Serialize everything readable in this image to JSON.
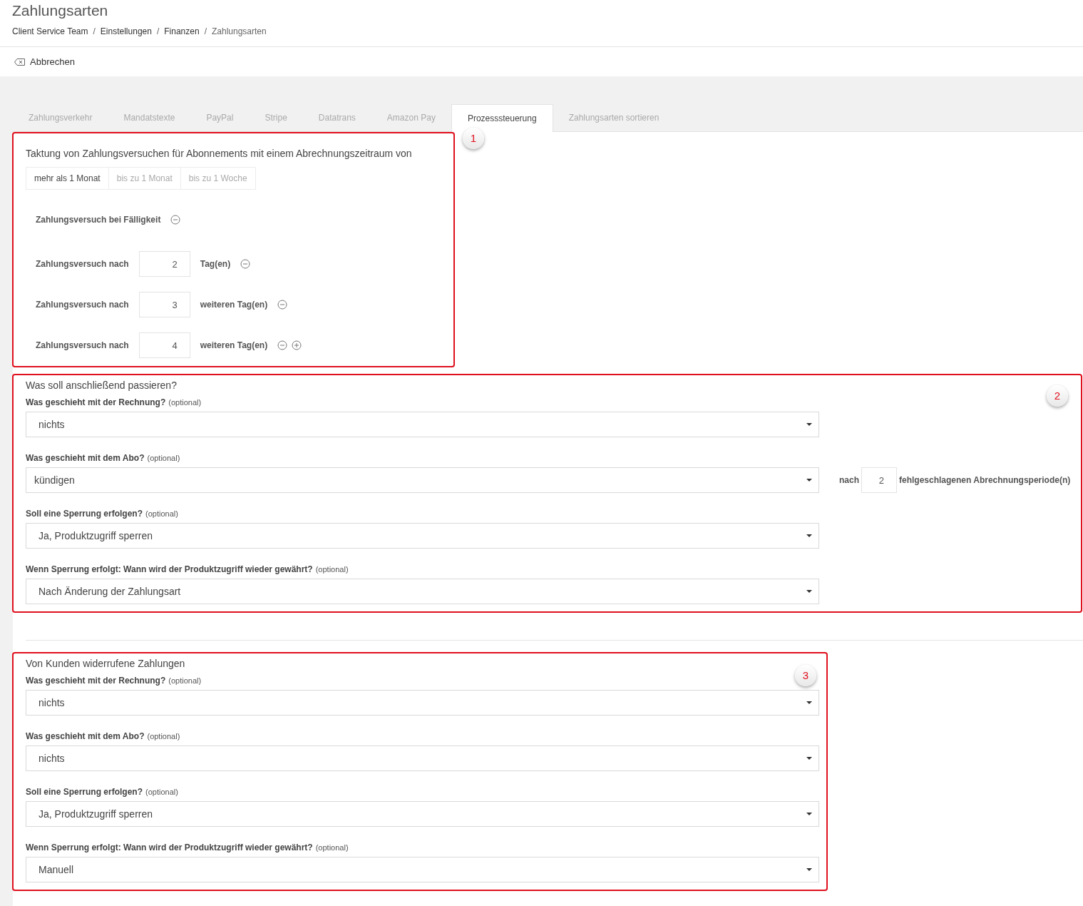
{
  "page_title": "Zahlungsarten",
  "breadcrumb": [
    {
      "label": "Client Service Team",
      "current": false
    },
    {
      "label": "Einstellungen",
      "current": false
    },
    {
      "label": "Finanzen",
      "current": false
    },
    {
      "label": "Zahlungsarten",
      "current": true
    }
  ],
  "breadcrumb_separator": "/",
  "cancel_button": "Abbrechen",
  "tabs": [
    {
      "label": "Zahlungsverkehr",
      "selected": false
    },
    {
      "label": "Mandatstexte",
      "selected": false
    },
    {
      "label": "PayPal",
      "selected": false
    },
    {
      "label": "Stripe",
      "selected": false
    },
    {
      "label": "Datatrans",
      "selected": false
    },
    {
      "label": "Amazon Pay",
      "selected": false
    },
    {
      "label": "Prozesssteuerung",
      "selected": true
    },
    {
      "label": "Zahlungsarten sortieren",
      "selected": false
    }
  ],
  "schedule": {
    "annotation": "1",
    "title": "Taktung von Zahlungsversuchen für Abonnements mit einem Abrechnungszeitraum von",
    "periods": [
      {
        "label": "mehr als 1 Monat",
        "selected": true
      },
      {
        "label": "bis zu 1 Monat",
        "selected": false
      },
      {
        "label": "bis zu 1 Woche",
        "selected": false
      }
    ],
    "attempts": [
      {
        "kind": "due",
        "label": "Zahlungsversuch bei Fälligkeit",
        "can_add": false
      },
      {
        "kind": "after",
        "label": "Zahlungsversuch nach",
        "value": "2",
        "unit": "Tag(en)",
        "can_add": false
      },
      {
        "kind": "after",
        "label": "Zahlungsversuch nach",
        "value": "3",
        "unit": "weiteren Tag(en)",
        "can_add": false
      },
      {
        "kind": "after",
        "label": "Zahlungsversuch nach",
        "value": "4",
        "unit": "weiteren Tag(en)",
        "can_add": true
      }
    ]
  },
  "sections": [
    {
      "annotation": "2",
      "title": "Was soll anschließend passieren?",
      "wide": true,
      "fields": [
        {
          "label": "Was geschieht mit der Rechnung?",
          "hint": "(optional)",
          "value": "nichts"
        },
        {
          "label": "Was geschieht mit dem Abo?",
          "hint": "(optional)",
          "value": "kündigen",
          "extra": {
            "label": "nach",
            "value": "2",
            "unit": "fehlgeschlagenen Abrechnungsperiode(n)"
          }
        },
        {
          "label": "Soll eine Sperrung erfolgen?",
          "hint": "(optional)",
          "value": "Ja, Produktzugriff sperren"
        },
        {
          "label": "Wenn Sperrung erfolgt: Wann wird der Produktzugriff wieder gewährt?",
          "hint": "(optional)",
          "value": "Nach Änderung der Zahlungsart"
        }
      ]
    },
    {
      "annotation": "3",
      "title": "Von Kunden widerrufene Zahlungen",
      "wide": false,
      "fields": [
        {
          "label": "Was geschieht mit der Rechnung?",
          "hint": "(optional)",
          "value": "nichts"
        },
        {
          "label": "Was geschieht mit dem Abo?",
          "hint": "(optional)",
          "value": "nichts"
        },
        {
          "label": "Soll eine Sperrung erfolgen?",
          "hint": "(optional)",
          "value": "Ja, Produktzugriff sperren"
        },
        {
          "label": "Wenn Sperrung erfolgt: Wann wird der Produktzugriff wieder gewährt?",
          "hint": "(optional)",
          "value": "Manuell"
        }
      ]
    }
  ]
}
